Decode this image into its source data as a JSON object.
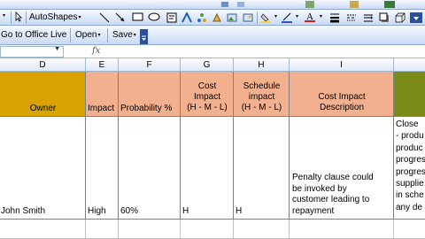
{
  "toolbar": {
    "autoshapes_label": "AutoShapes",
    "go_office_live_label": "Go to Office Live",
    "open_label": "Open",
    "save_label": "Save"
  },
  "formula_bar": {
    "name_box_value": "",
    "fx_label": "fx"
  },
  "columns": [
    {
      "letter": "D"
    },
    {
      "letter": "E"
    },
    {
      "letter": "F"
    },
    {
      "letter": "G"
    },
    {
      "letter": "H"
    },
    {
      "letter": "I"
    }
  ],
  "headers": {
    "owner": "Owner",
    "impact": "Impact",
    "probability": "Probability %",
    "cost_impact": "Cost\nImpact\n(H - M - L)",
    "schedule_impact": "Schedule\nimpact\n(H - M - L)",
    "cost_desc": "Cost Impact\nDescription"
  },
  "row": {
    "owner": "John Smith",
    "impact": "High",
    "probability": "60%",
    "cost_impact": "H",
    "schedule_impact": "H",
    "cost_desc": "Penalty clause could\nbe invoked by\ncustomer leading to\nrepayment",
    "next_col": "Close\n- produ\nproduc\nprogres\nprogres\nsupplie\nin sche\nany de"
  },
  "colors": {
    "owner_header": "#d8a300",
    "peach_header": "#f2b08e",
    "olive_header": "#7c8a17",
    "toolbar": "#c9daf5"
  }
}
